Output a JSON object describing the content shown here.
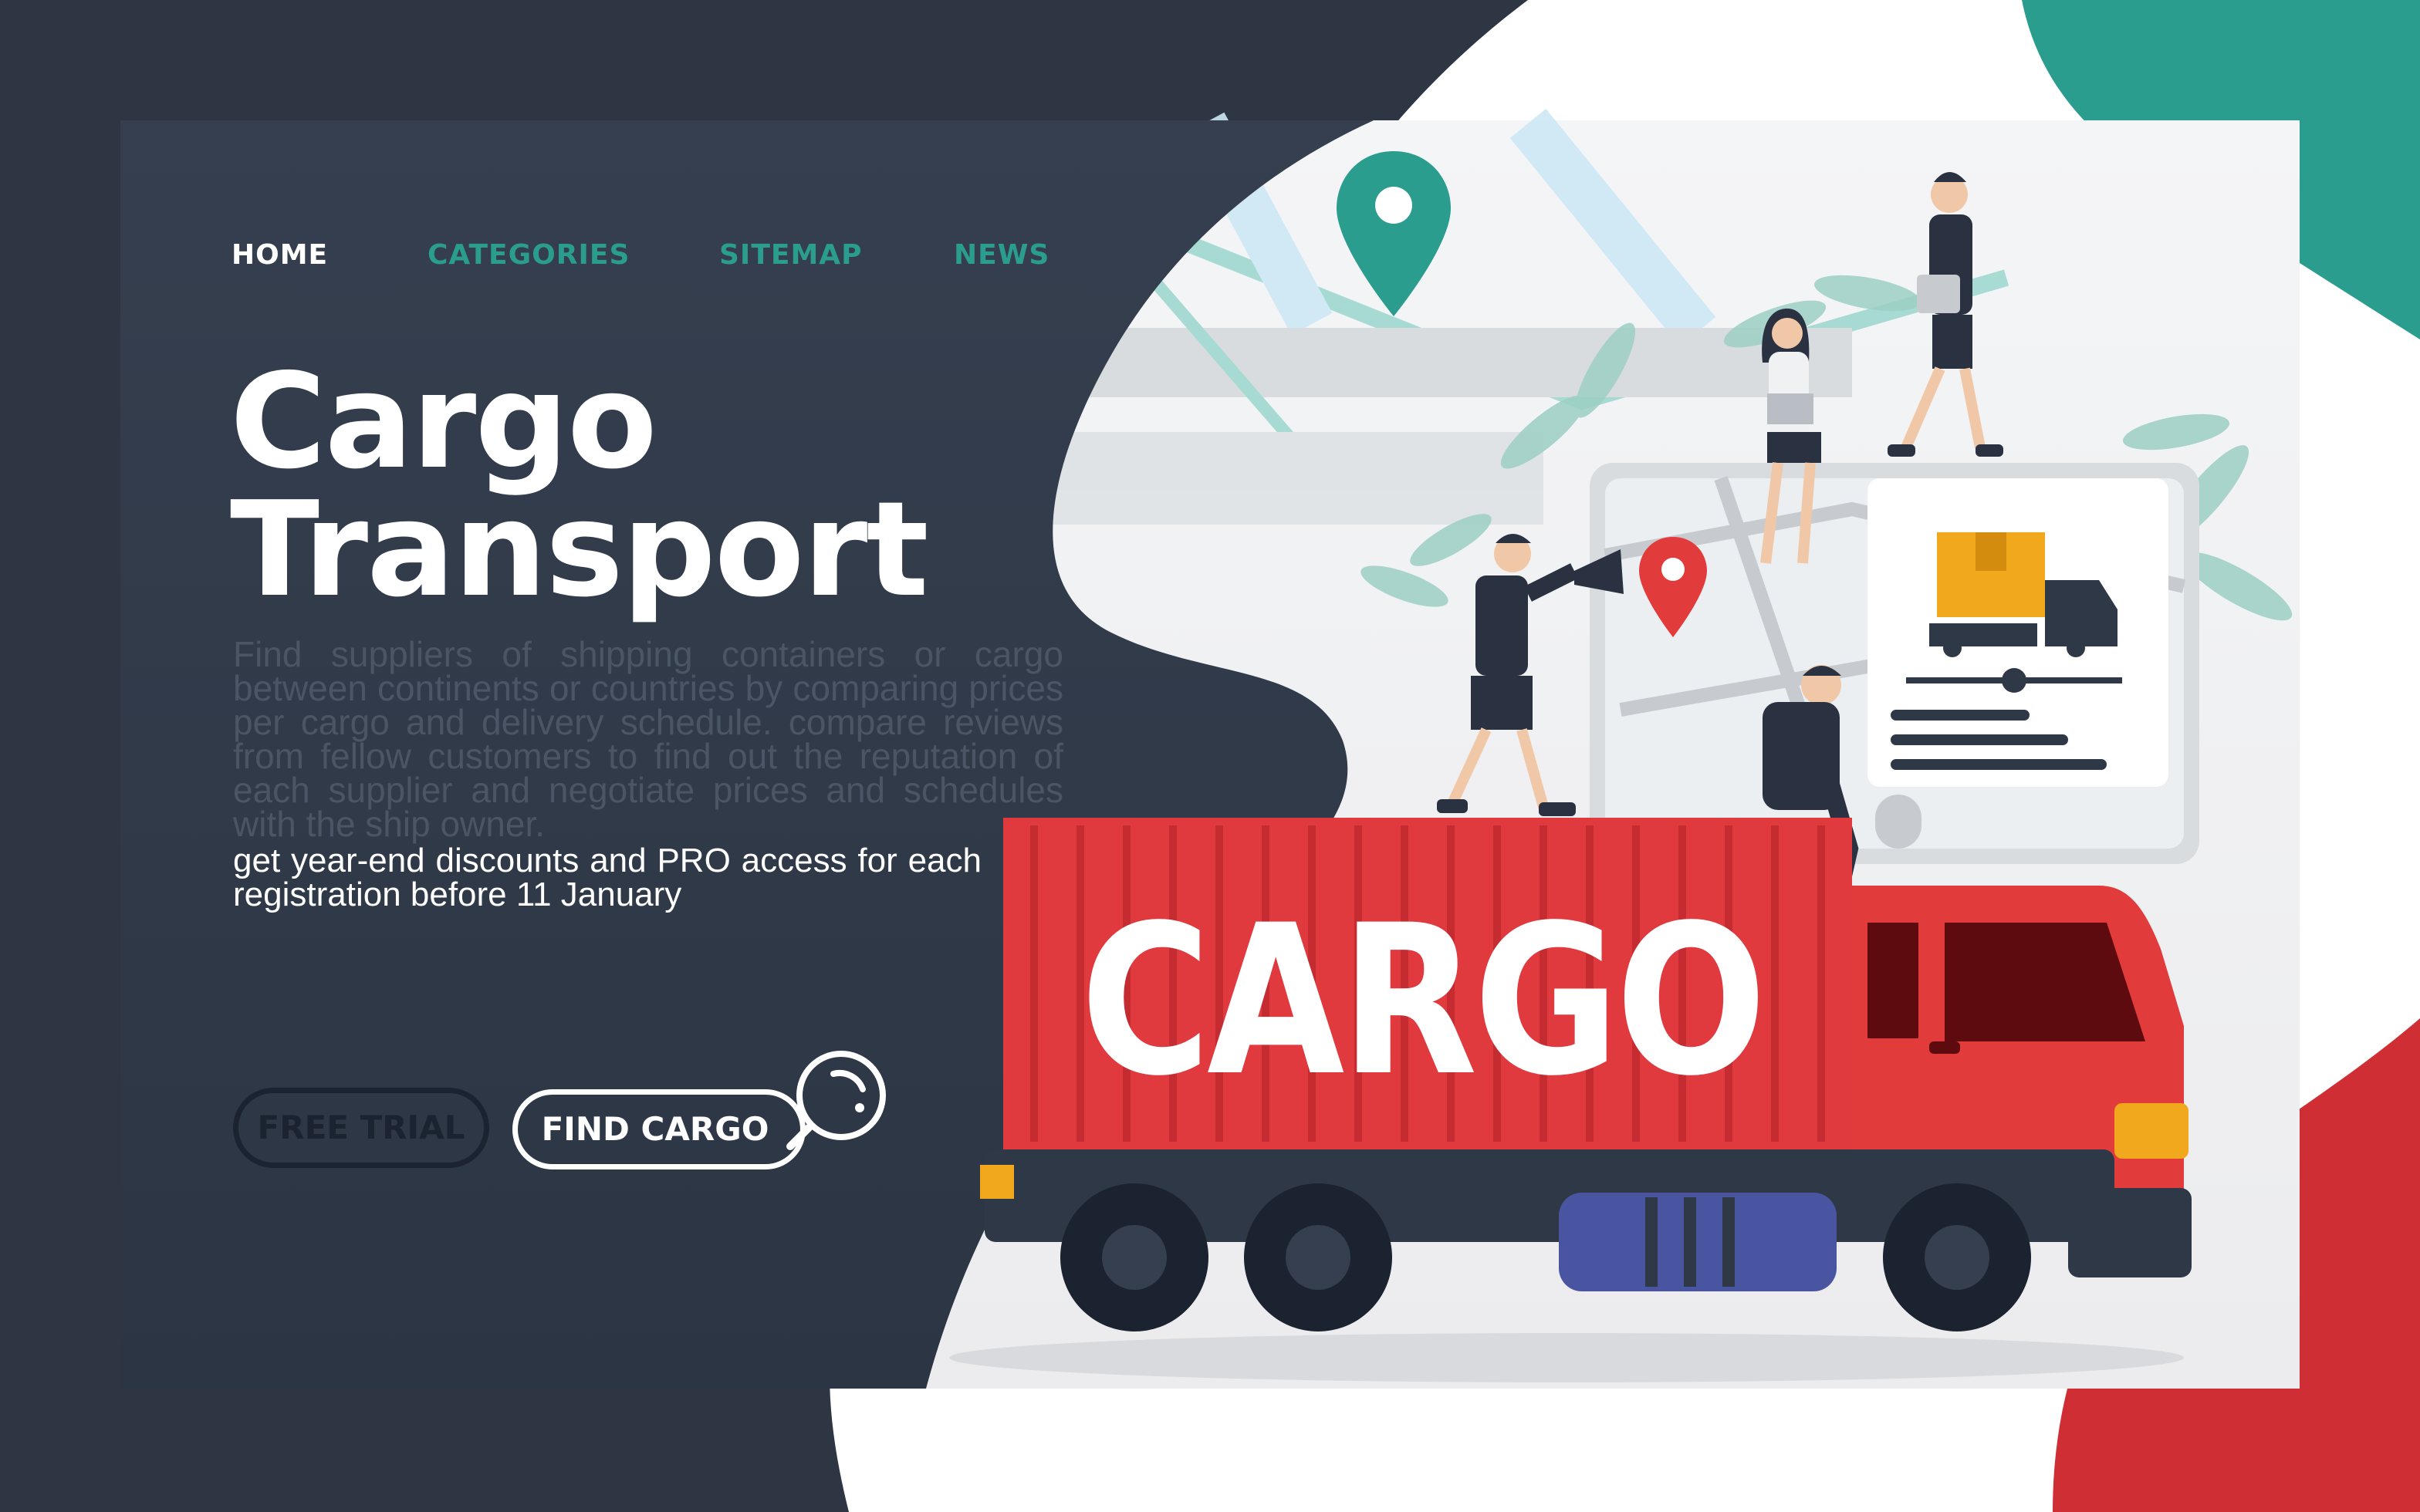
{
  "nav": {
    "items": [
      "HOME",
      "CATEGORIES",
      "SITEMAP",
      "NEWS"
    ]
  },
  "hero": {
    "title_line1": "Cargo",
    "title_line2": "Transport",
    "body": "Find suppliers of shipping containers or cargo between continents or countries by comparing prices per cargo and delivery schedule. compare reviews from fellow customers to find out the reputation of each supplier and negotiate prices and schedules with the ship owner.",
    "highlight": "get year-end discounts and PRO access for each registration before 11 January"
  },
  "buttons": {
    "free_trial": "FREE TRIAL",
    "find_cargo": "FIND CARGO"
  },
  "illustration": {
    "container_text": "CARGO",
    "colors": {
      "panel": "#303a4a",
      "teal": "#2a9d8f",
      "truck_red": "#e0393e",
      "cab_red": "#e23b3b",
      "fuel_tank": "#4a55a2",
      "box": "#f2a81d"
    }
  }
}
